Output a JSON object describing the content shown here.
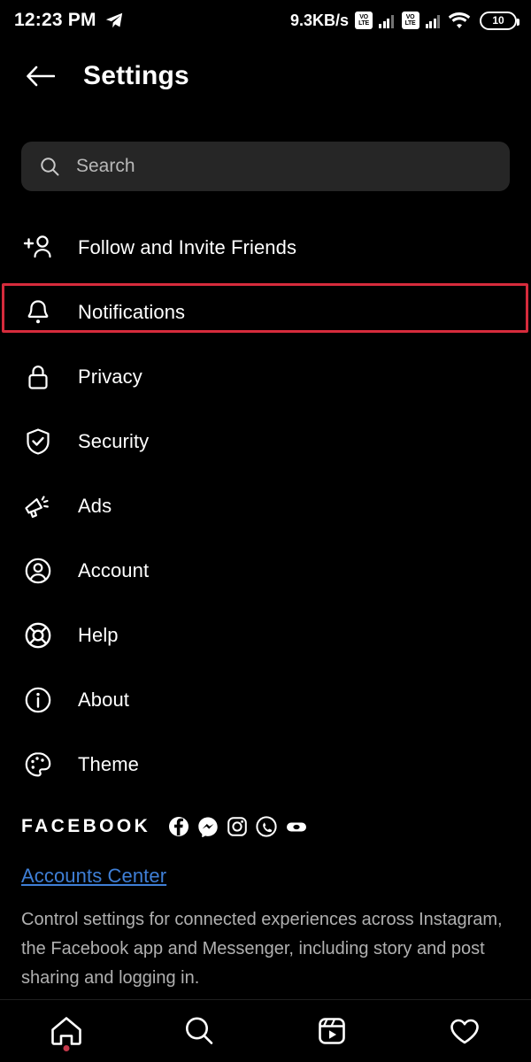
{
  "status_bar": {
    "time": "12:23 PM",
    "send_icon": "telegram-send-icon",
    "network_speed": "9.3KB/s",
    "volte_top": "VO",
    "volte_bottom": "LTE",
    "sim1_icon": "volte-signal-icon",
    "sim2_icon": "volte-signal-icon",
    "wifi_icon": "wifi-icon",
    "battery_level": "10"
  },
  "header": {
    "back_icon": "back-arrow-icon",
    "title": "Settings"
  },
  "search": {
    "icon": "search-icon",
    "placeholder": "Search",
    "value": ""
  },
  "menu": {
    "items": [
      {
        "label": "Follow and Invite Friends",
        "icon": "person-plus-icon",
        "highlighted": false
      },
      {
        "label": "Notifications",
        "icon": "bell-icon",
        "highlighted": true
      },
      {
        "label": "Privacy",
        "icon": "lock-icon",
        "highlighted": false
      },
      {
        "label": "Security",
        "icon": "shield-check-icon",
        "highlighted": false
      },
      {
        "label": "Ads",
        "icon": "megaphone-icon",
        "highlighted": false
      },
      {
        "label": "Account",
        "icon": "account-circle-icon",
        "highlighted": false
      },
      {
        "label": "Help",
        "icon": "life-ring-icon",
        "highlighted": false
      },
      {
        "label": "About",
        "icon": "info-circle-icon",
        "highlighted": false
      },
      {
        "label": "Theme",
        "icon": "palette-icon",
        "highlighted": false
      }
    ]
  },
  "annotation": {
    "target": "Notifications",
    "color": "#d62b3c"
  },
  "facebook_section": {
    "brand": "FACEBOOK",
    "apps": [
      "facebook-icon",
      "messenger-icon",
      "instagram-icon",
      "whatsapp-icon",
      "oculus-icon"
    ],
    "accounts_center_link": "Accounts Center",
    "link_color": "#3f7fd6",
    "description": "Control settings for connected experiences across Instagram, the Facebook app and Messenger, including story and post sharing and logging in."
  },
  "bottom_nav": {
    "items": [
      {
        "name": "home",
        "icon": "home-icon",
        "active": true
      },
      {
        "name": "search",
        "icon": "search-icon",
        "active": false
      },
      {
        "name": "reels",
        "icon": "reels-icon",
        "active": false
      },
      {
        "name": "activity",
        "icon": "heart-icon",
        "active": false
      }
    ]
  },
  "theme": {
    "background": "#000000",
    "text": "#ffffff",
    "muted_text": "#b0b0b0",
    "field_background": "#262626"
  }
}
